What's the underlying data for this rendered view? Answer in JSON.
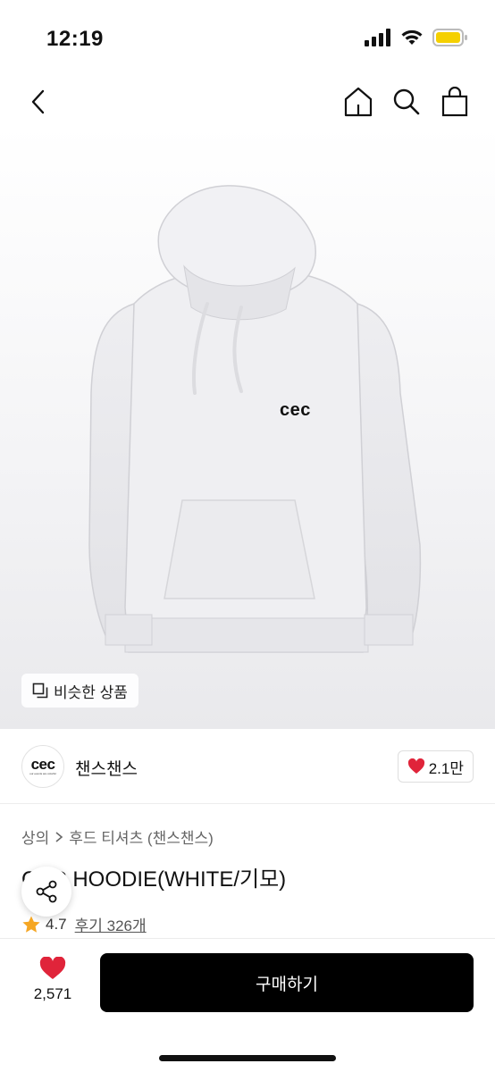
{
  "status_bar": {
    "time": "12:19"
  },
  "nav": {
    "back_icon": "chevron-left-icon",
    "home_icon": "home-icon",
    "search_icon": "search-icon",
    "cart_icon": "shopping-bag-icon"
  },
  "product_image": {
    "alt": "cec hoodie white",
    "print_text": "cec",
    "similar_label": "비슷한 상품"
  },
  "brand": {
    "logo_text": "cec",
    "logo_sub": "our events are colorful",
    "name": "챈스챈스",
    "likes": "2.1만",
    "like_color": "#e0243a"
  },
  "breadcrumb": [
    "상의",
    "후드 티셔츠 (챈스챈스)"
  ],
  "product": {
    "title": "CEC HOODIE(WHITE/기모)",
    "title_visible": "C  C HOODIE(WHITE/기모)",
    "rating": "4.7",
    "review_label": "후기 326개",
    "star_color": "#f5a623"
  },
  "bottom_bar": {
    "wish_count": "2,571",
    "buy_label": "구매하기"
  }
}
